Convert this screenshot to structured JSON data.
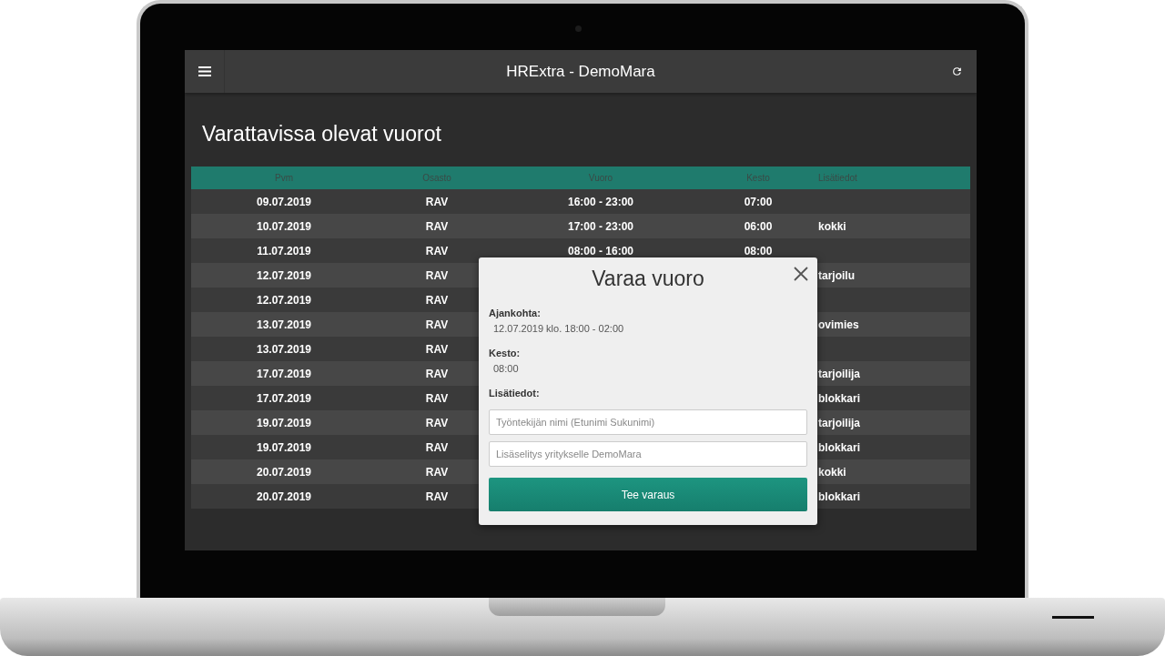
{
  "app_bar": {
    "title": "HRExtra - DemoMara"
  },
  "page_title": "Varattavissa olevat vuorot",
  "table": {
    "columns": [
      "Pvm",
      "Osasto",
      "Vuoro",
      "Kesto",
      "Lisätiedot"
    ],
    "rows": [
      {
        "pvm": "09.07.2019",
        "osasto": "RAV",
        "vuoro": "16:00 - 23:00",
        "kesto": "07:00"
      },
      {
        "pvm": "10.07.2019",
        "osasto": "RAV",
        "vuoro": "17:00 - 23:00",
        "kesto": "06:00",
        "lisatiedot": "kokki"
      },
      {
        "pvm": "11.07.2019",
        "osasto": "RAV",
        "vuoro": "08:00 - 16:00",
        "kesto": "08:00"
      },
      {
        "pvm": "12.07.2019",
        "osasto": "RAV",
        "lisatiedot": "tarjoilu"
      },
      {
        "pvm": "12.07.2019",
        "osasto": "RAV"
      },
      {
        "pvm": "13.07.2019",
        "osasto": "RAV",
        "lisatiedot": "ovimies"
      },
      {
        "pvm": "13.07.2019",
        "osasto": "RAV"
      },
      {
        "pvm": "17.07.2019",
        "osasto": "RAV",
        "lisatiedot": "tarjoilija"
      },
      {
        "pvm": "17.07.2019",
        "osasto": "RAV",
        "lisatiedot": "blokkari"
      },
      {
        "pvm": "19.07.2019",
        "osasto": "RAV",
        "lisatiedot": "tarjoilija"
      },
      {
        "pvm": "19.07.2019",
        "osasto": "RAV",
        "lisatiedot": "blokkari"
      },
      {
        "pvm": "20.07.2019",
        "osasto": "RAV",
        "lisatiedot": "kokki"
      },
      {
        "pvm": "20.07.2019",
        "osasto": "RAV",
        "lisatiedot": "blokkari"
      }
    ]
  },
  "dialog": {
    "title": "Varaa vuoro",
    "fields": [
      {
        "label": "Ajankohta:",
        "value": "12.07.2019 klo. 18:00 - 02:00"
      },
      {
        "label": "Kesto:",
        "value": "08:00"
      },
      {
        "label": "Lisätiedot:"
      }
    ],
    "inputs": [
      {
        "placeholder": "Työntekijän nimi (Etunimi Sukunimi)"
      },
      {
        "placeholder": "Lisäselitys yritykselle DemoMara"
      }
    ],
    "submit": "Tee varaus"
  }
}
